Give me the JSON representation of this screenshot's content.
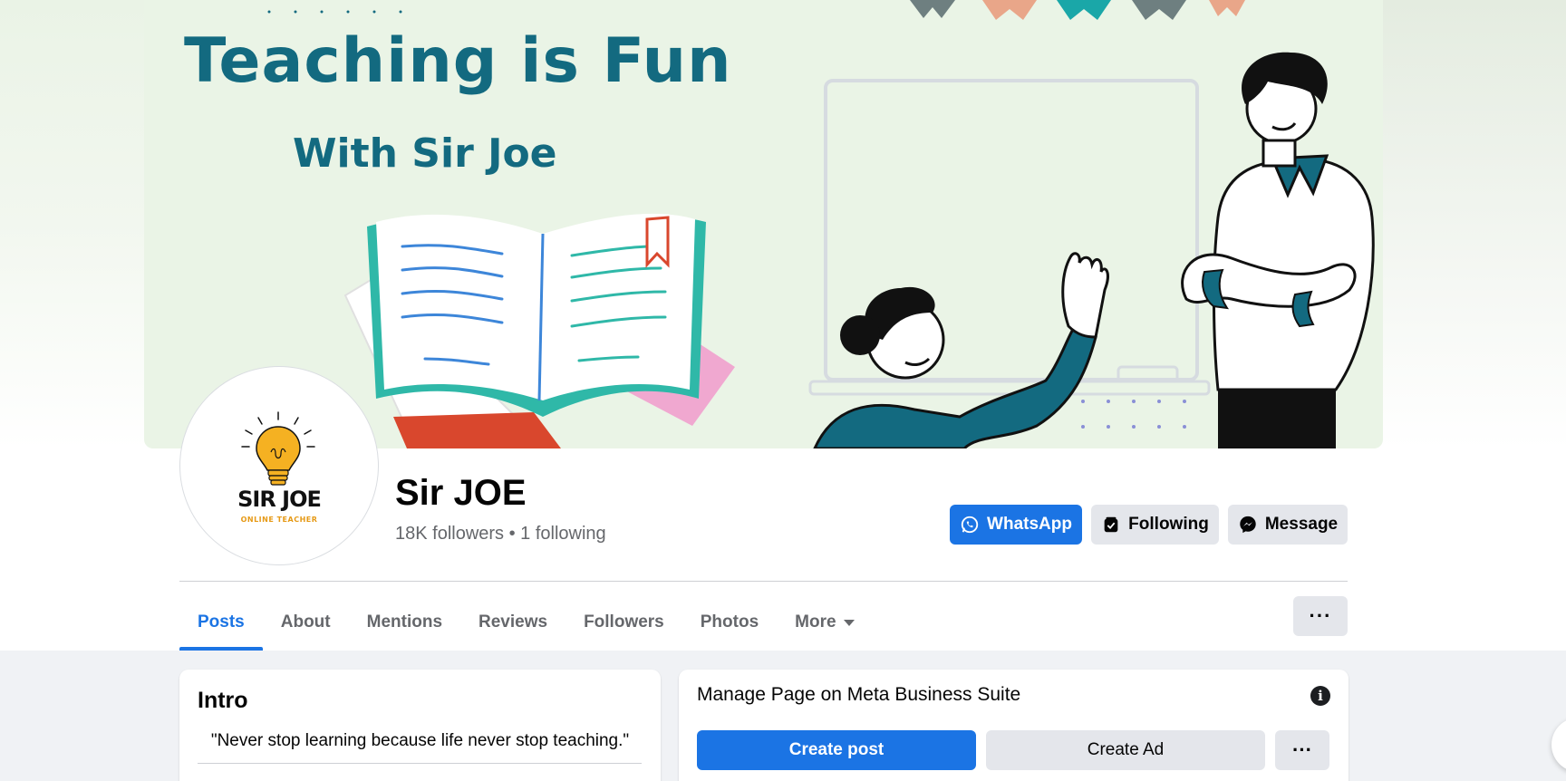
{
  "cover": {
    "title": "Teaching is Fun",
    "subtitle": "With Sir Joe"
  },
  "profile_logo": {
    "text": "SIR JOE",
    "subtext": "ONLINE TEACHER"
  },
  "page": {
    "name": "Sir JOE",
    "stats": "18K followers • 1 following"
  },
  "actions": {
    "whatsapp": "WhatsApp",
    "following": "Following",
    "message": "Message"
  },
  "tabs": [
    {
      "label": "Posts",
      "active": true
    },
    {
      "label": "About"
    },
    {
      "label": "Mentions"
    },
    {
      "label": "Reviews"
    },
    {
      "label": "Followers"
    },
    {
      "label": "Photos"
    },
    {
      "label": "More"
    }
  ],
  "tabs_more_button": "···",
  "intro": {
    "title": "Intro",
    "quote": "\"Never stop learning because life never stop teaching.\""
  },
  "manage": {
    "title": "Manage Page on Meta Business Suite",
    "info_icon": "i",
    "create_post": "Create post",
    "create_ad": "Create Ad",
    "more": "···"
  },
  "colors": {
    "accent": "#1b74e4",
    "cover_text": "#136a80",
    "teal": "#136a80",
    "secondary_button": "#e4e6eb"
  }
}
